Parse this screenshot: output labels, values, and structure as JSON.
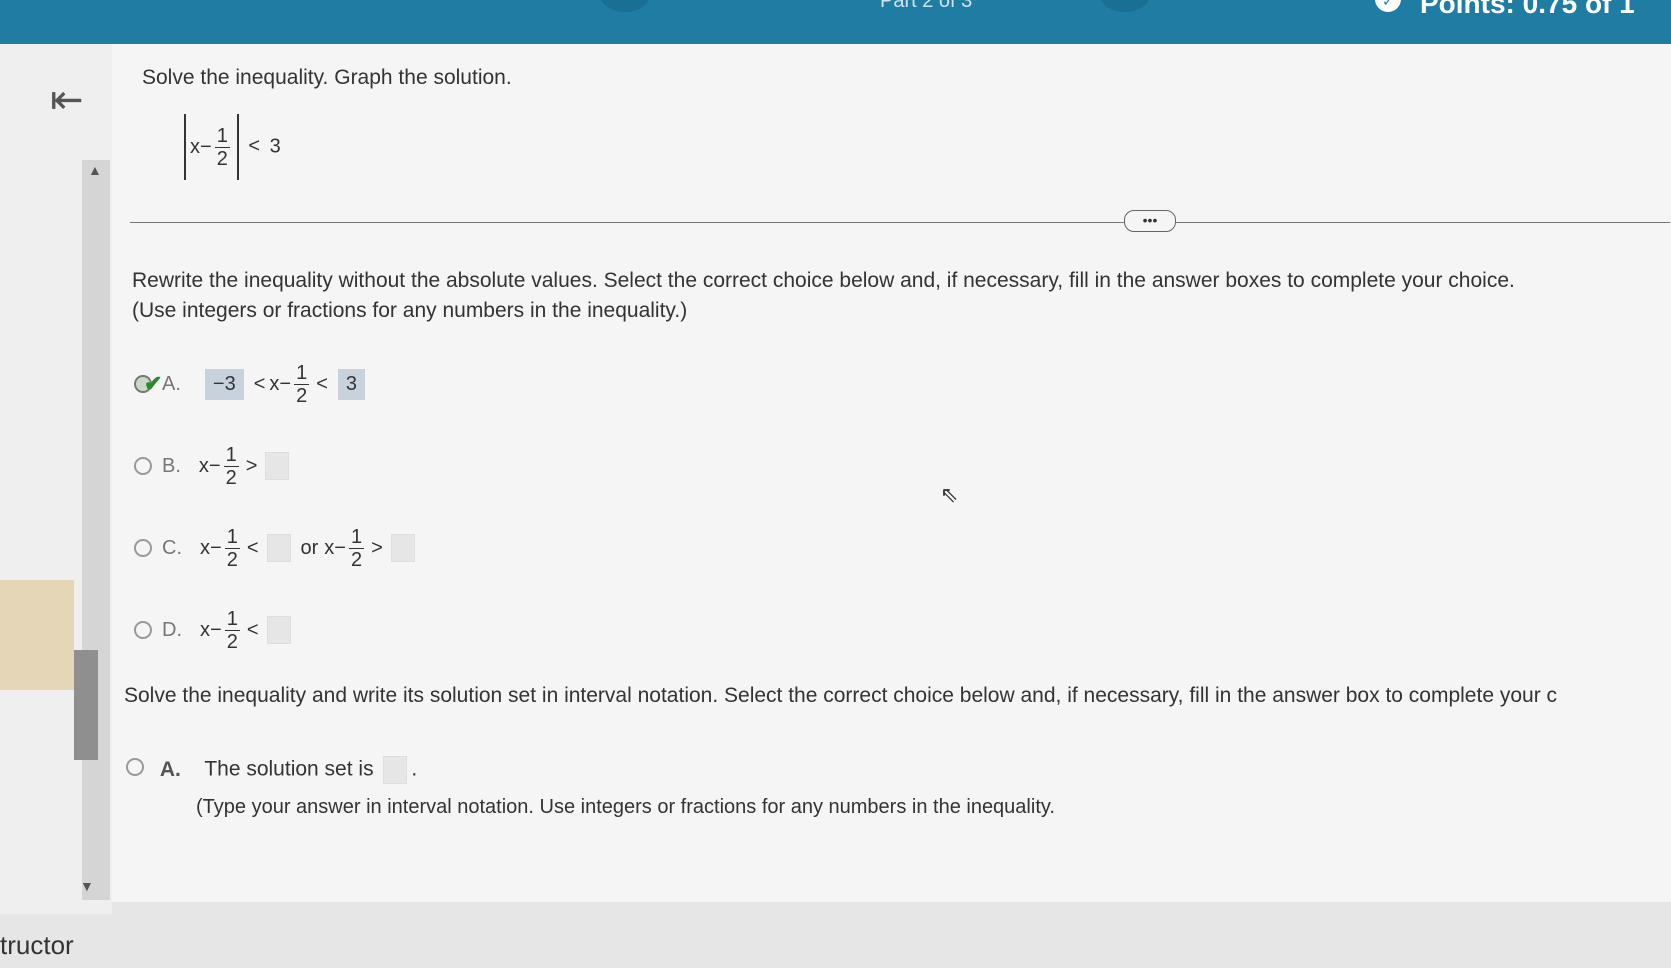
{
  "header": {
    "part_label": "Part 2 of 3",
    "points_label": "Points: 0.75 of 1",
    "points_icon": "check-icon"
  },
  "nav": {
    "back_icon": "first-page-icon",
    "scroll_up_icon": "triangle-up-icon",
    "scroll_down_icon": "triangle-down-icon"
  },
  "sidebar": {
    "instructor_fragment": "tructor"
  },
  "question": {
    "title": "Solve the inequality. Graph the solution.",
    "problem": {
      "var": "x",
      "minus": "−",
      "frac_num": "1",
      "frac_den": "2",
      "lt": "<",
      "rhs": "3"
    },
    "more_label": "•••"
  },
  "part1": {
    "instruction_line1": "Rewrite the inequality without the absolute values. Select the correct choice below and, if necessary, fill in the answer boxes to complete your choice.",
    "instruction_line2": "(Use integers or fractions for any numbers in the inequality.)",
    "choices": [
      {
        "letter": "A.",
        "selected": true,
        "left_value": "−3",
        "lt": "<",
        "expr_var": "x",
        "minus": "−",
        "frac_num": "1",
        "frac_den": "2",
        "right_value": "3"
      },
      {
        "letter": "B.",
        "selected": false,
        "expr_var": "x",
        "minus": "−",
        "frac_num": "1",
        "frac_den": "2",
        "op": ">"
      },
      {
        "letter": "C.",
        "selected": false,
        "expr_var": "x",
        "minus": "−",
        "frac_num": "1",
        "frac_den": "2",
        "op": "<",
        "or": "or",
        "op2": ">"
      },
      {
        "letter": "D.",
        "selected": false,
        "expr_var": "x",
        "minus": "−",
        "frac_num": "1",
        "frac_den": "2",
        "op": "<"
      }
    ]
  },
  "part2": {
    "instruction": "Solve the inequality and write its solution set in interval notation. Select the correct choice below and, if necessary, fill in the answer box to complete your c",
    "choice_a_letter": "A.",
    "choice_a_text": "The solution set is",
    "choice_a_period": ".",
    "choice_a_note": "(Type your answer in interval notation. Use integers or fractions for any numbers in the inequality."
  },
  "colors": {
    "header_bg": "#1f7da4",
    "filled_answer_bg": "#c7d2dd",
    "check_green": "#2a8a2a"
  }
}
